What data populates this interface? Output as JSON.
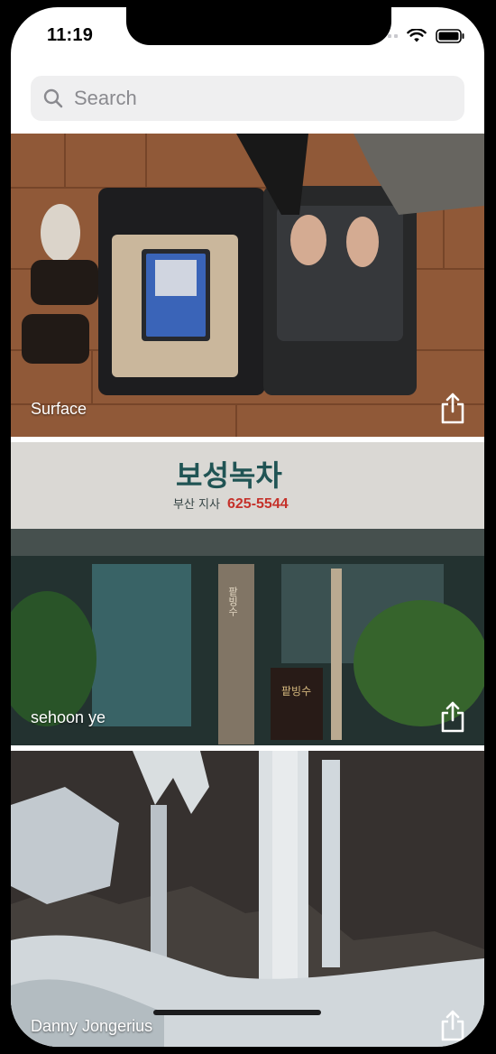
{
  "status_bar": {
    "time": "11:19",
    "wifi_icon": "wifi-icon",
    "battery_icon": "battery-icon"
  },
  "search": {
    "placeholder": "Search",
    "icon": "search-icon"
  },
  "feed": {
    "cards": [
      {
        "label": "Surface",
        "action_icon": "share-icon"
      },
      {
        "label": "sehoon ye",
        "action_icon": "share-icon"
      },
      {
        "label": "Danny Jongerius",
        "action_icon": "share-icon"
      }
    ]
  },
  "photo_text": {
    "sign_korean": "보성녹차",
    "sign_sub": "부산 지사",
    "sign_phone": "625-5544",
    "sign_vertical": "팥빙수",
    "board_text": "팥빙수"
  },
  "colors": {
    "screen_bg": "#ffffff",
    "search_bg": "#efeff0",
    "placeholder": "#8a8a8f",
    "label_text": "#ffffff"
  }
}
